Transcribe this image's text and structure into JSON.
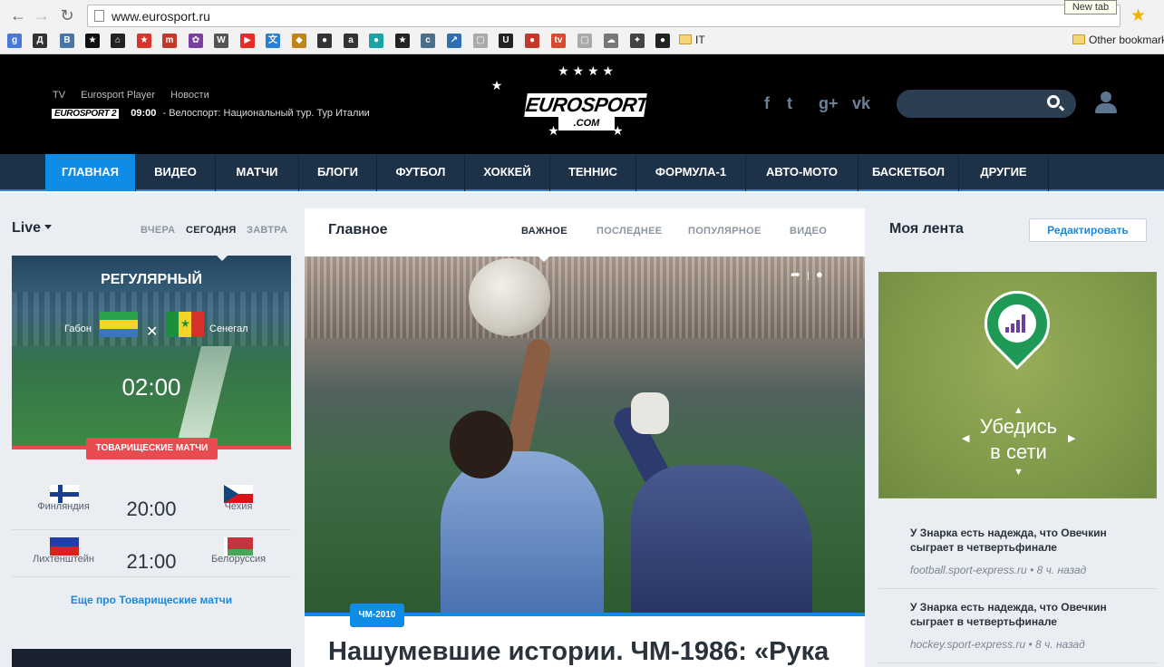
{
  "browser": {
    "url": "www.eurosport.ru",
    "newtab_tooltip": "New tab",
    "bookmarks": [
      {
        "icon": "google-icon",
        "glyph": "g",
        "color": "#4a77d8"
      },
      {
        "icon": "d-icon",
        "glyph": "Д",
        "color": "#333333"
      },
      {
        "icon": "vk-icon",
        "glyph": "В",
        "color": "#4a76a8"
      },
      {
        "icon": "star-bookmark-icon",
        "glyph": "★",
        "color": "#111111"
      },
      {
        "icon": "home-icon",
        "glyph": "⌂",
        "color": "#222222"
      },
      {
        "icon": "red-star-icon",
        "glyph": "★",
        "color": "#d9342b"
      },
      {
        "icon": "md-icon",
        "glyph": "m",
        "color": "#c0392b"
      },
      {
        "icon": "flower-icon",
        "glyph": "✿",
        "color": "#7b3fa0"
      },
      {
        "icon": "wikipedia-icon",
        "glyph": "W",
        "color": "#555555"
      },
      {
        "icon": "youtube-icon",
        "glyph": "▶",
        "color": "#e52d27"
      },
      {
        "icon": "translate-icon",
        "glyph": "文",
        "color": "#2a7fd4"
      },
      {
        "icon": "game-icon",
        "glyph": "◆",
        "color": "#c0841a"
      },
      {
        "icon": "nhl-icon",
        "glyph": "●",
        "color": "#333333"
      },
      {
        "icon": "amazon-icon",
        "glyph": "a",
        "color": "#333333"
      },
      {
        "icon": "circle-icon",
        "glyph": "●",
        "color": "#1aa3a3"
      },
      {
        "icon": "star-bookmark-icon",
        "glyph": "★",
        "color": "#222222"
      },
      {
        "icon": "c-icon",
        "glyph": "c",
        "color": "#4b6e8a"
      },
      {
        "icon": "arrow-icon",
        "glyph": "↗",
        "color": "#2d6fb3"
      },
      {
        "icon": "page-icon",
        "glyph": "▢",
        "color": "#aaaaaa"
      },
      {
        "icon": "u-icon",
        "glyph": "U",
        "color": "#222222"
      },
      {
        "icon": "ball-icon",
        "glyph": "●",
        "color": "#c0392b"
      },
      {
        "icon": "tv-icon",
        "glyph": "tv",
        "color": "#d64b2b"
      },
      {
        "icon": "page-icon",
        "glyph": "▢",
        "color": "#aaaaaa"
      },
      {
        "icon": "cloud-icon",
        "glyph": "☁",
        "color": "#777777"
      },
      {
        "icon": "hockey-icon",
        "glyph": "✦",
        "color": "#444444"
      },
      {
        "icon": "github-icon",
        "glyph": "●",
        "color": "#222222"
      }
    ],
    "folder_it": "IT",
    "folder_other": "Other bookmarks"
  },
  "header": {
    "links": [
      "TV",
      "Eurosport Player",
      "Новости"
    ],
    "channel_logo": "EUROSPORT 2",
    "live_time": "09:00",
    "live_text": "- Велоспорт: Национальный тур. Тур Италии",
    "logo_word": "EUROSPORT",
    "logo_domain": ".COM",
    "social": [
      "f",
      "t",
      "g+",
      "vk"
    ]
  },
  "nav": {
    "items": [
      "ГЛАВНАЯ",
      "ВИДЕО",
      "МАТЧИ",
      "БЛОГИ",
      "ФУТБОЛ",
      "ХОККЕЙ",
      "ТЕННИС",
      "ФОРМУЛА-1",
      "АВТО-МОТО",
      "БАСКЕТБОЛ",
      "ДРУГИЕ"
    ],
    "active": "ГЛАВНАЯ"
  },
  "live": {
    "title": "Live",
    "days": [
      "ВЧЕРА",
      "СЕГОДНЯ",
      "ЗАВТРА"
    ],
    "active_day": "СЕГОДНЯ",
    "card": {
      "type": "РЕГУЛЯРНЫЙ",
      "home": "Габон",
      "away": "Сенегал",
      "time": "02:00",
      "competition": "ТОВАРИЩЕСКИЕ МАТЧИ"
    },
    "fixtures": [
      {
        "home": "Финляндия",
        "time": "20:00",
        "away": "Чехия"
      },
      {
        "home": "Лихтенштейн",
        "time": "21:00",
        "away": "Белоруссия"
      }
    ],
    "more_link": "Еще про Товарищеские матчи"
  },
  "main": {
    "title": "Главное",
    "tabs": [
      "ВАЖНОЕ",
      "ПОСЛЕДНЕЕ",
      "ПОПУЛЯРНОЕ",
      "ВИДЕО"
    ],
    "active_tab": "ВАЖНОЕ",
    "tag": "ЧМ-2010",
    "headline": "Нашумевшие истории. ЧМ-1986: «Рука"
  },
  "feed": {
    "title": "Моя лента",
    "edit_label": "Редактировать",
    "ad_text_line1": "Убедись",
    "ad_text_line2": "в сети",
    "items": [
      {
        "headline": "У Знарка есть надежда, что Овечкин сыграет в четвертьфинале",
        "source": "football.sport-express.ru",
        "age": "• 8 ч. назад"
      },
      {
        "headline": "У Знарка есть надежда, что Овечкин сыграет в четвертьфинале",
        "source": "hockey.sport-express.ru",
        "age": "• 8 ч. назад"
      }
    ]
  }
}
